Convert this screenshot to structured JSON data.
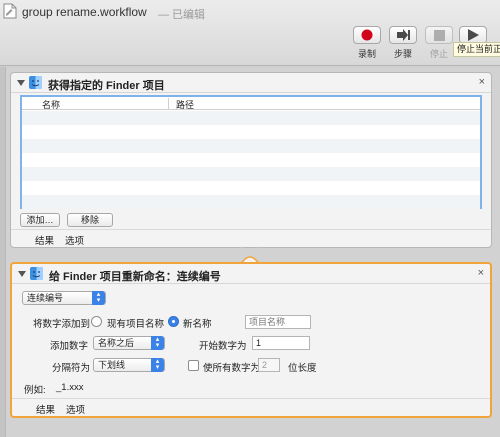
{
  "window": {
    "title": "group rename.workflow",
    "status": "— 已编辑"
  },
  "toolbar": {
    "record_label": "录制",
    "step_label": "步骤",
    "stop_label": "停止",
    "run_label": "运行",
    "run_tooltip": "停止当前正",
    "colors": {
      "record": "#d0021b",
      "icon": "#4a4a4a"
    }
  },
  "action1": {
    "title": "获得指定的 Finder 项目",
    "close_label": "×",
    "table": {
      "columns": [
        "名称",
        "路径"
      ],
      "rows": []
    },
    "add_label": "添加…",
    "remove_label": "移除",
    "footer": {
      "results": "结果",
      "options": "选项"
    }
  },
  "action2": {
    "title": "给 Finder 项目重新命名：连续编号",
    "close_label": "×",
    "mode_popup": "连续编号",
    "add_number_to_label": "将数字添加到",
    "existing_name_option": "现有项目名称",
    "new_name_option": "新名称",
    "new_name_placeholder": "项目名称",
    "add_number_label": "添加数字",
    "position_popup": "名称之后",
    "start_number_label": "开始数字为",
    "start_number_value": "1",
    "separator_label": "分隔符为",
    "separator_popup": "下划线",
    "all_digits_label": "使所有数字为",
    "digits_value": "2",
    "digits_suffix": "位长度",
    "example_label": "例如:",
    "example_value": "_1.xxx",
    "footer": {
      "results": "结果",
      "options": "选项"
    },
    "accent": "#f0a43a"
  }
}
